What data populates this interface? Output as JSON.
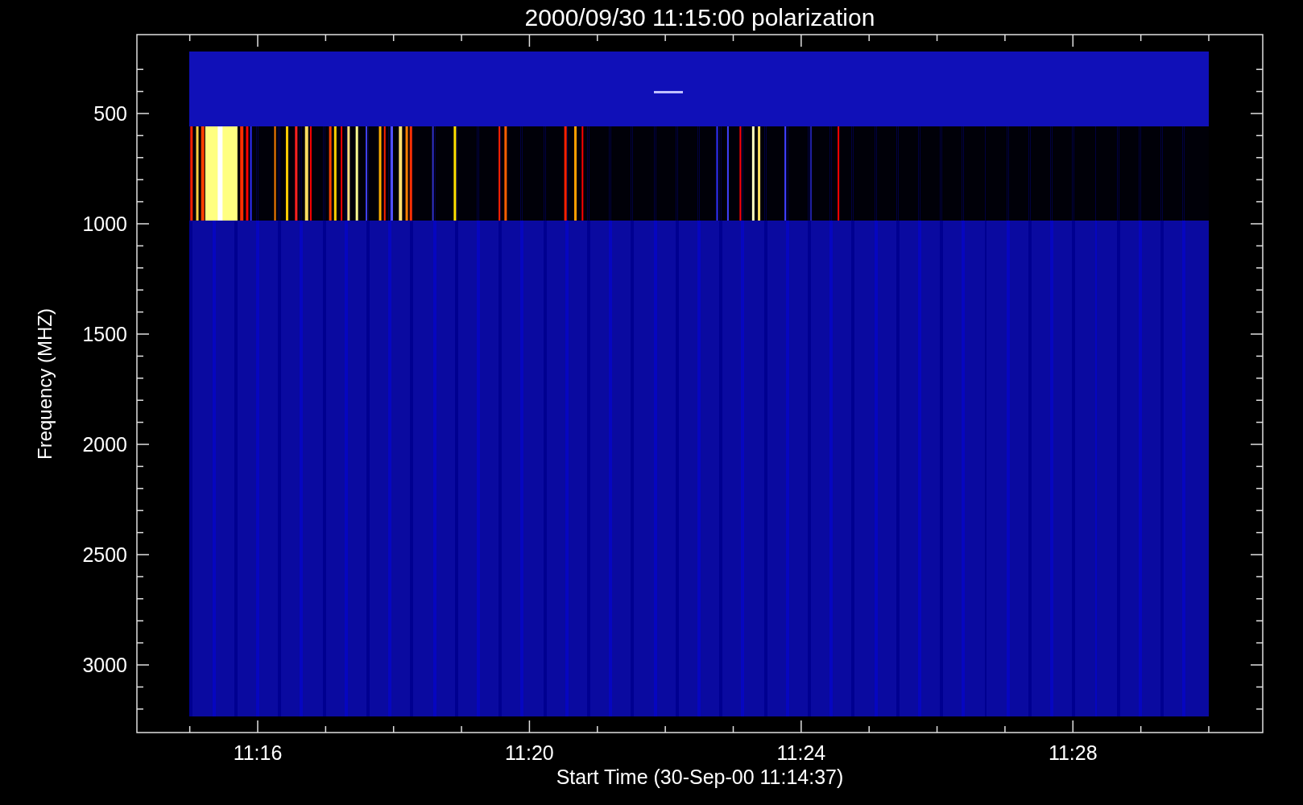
{
  "plot": {
    "title": "2000/09/30 11:15:00 polarization",
    "ylabel": "Frequency (MHZ)",
    "xlabel": "Start Time (30-Sep-00 11:14:37)",
    "yticks": [
      "500",
      "1000",
      "1500",
      "2000",
      "2500",
      "3000"
    ],
    "xticks": [
      "11:16",
      "11:20",
      "11:24",
      "11:28"
    ]
  }
}
